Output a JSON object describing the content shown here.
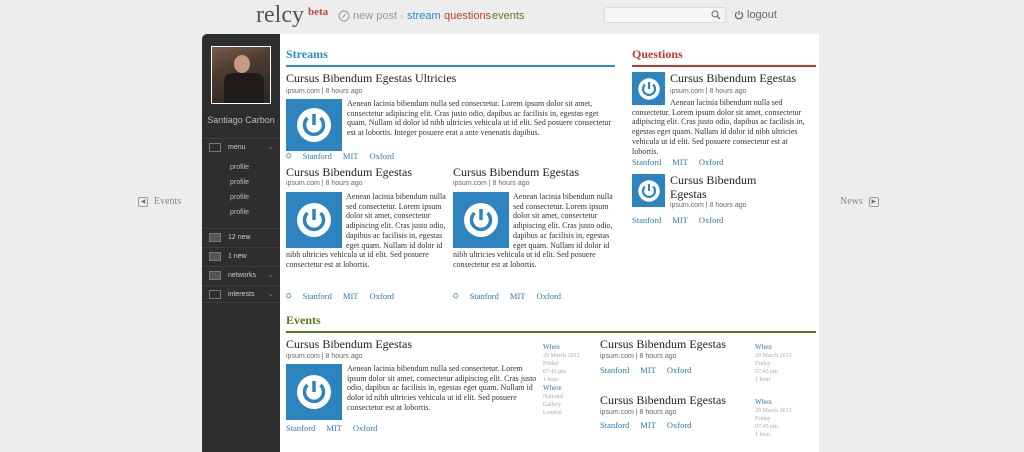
{
  "header": {
    "logo": "relcy",
    "beta": "beta",
    "newpost": "new post",
    "nav": [
      {
        "label": "stream",
        "color": "#2a8fc4"
      },
      {
        "label": "questions",
        "color": "#c0392b"
      },
      {
        "label": "events",
        "color": "#5b7a1e"
      }
    ],
    "search_placeholder": "",
    "logout": "logout"
  },
  "sidebar": {
    "username": "Santiago Carbon",
    "menu": "menu",
    "sub": [
      "profile",
      "profile",
      "profile",
      "profile"
    ],
    "new_a": "12 new",
    "new_b": "1 new",
    "networks": "networks",
    "interests": "interests"
  },
  "sidenav": {
    "left": "Events",
    "right": "News"
  },
  "streams": {
    "heading": "Streams",
    "main": {
      "title": "Cursus Bibendum Egestas Ultricies",
      "meta": "ipsum.com | 8 hours ago",
      "body": "Aenean lacinia bibendum nulla sed consectetur. Lorem ipsum dolor sit amet, consectetur adipiscing elit. Cras justo odio, dapibus ac facilisis in, egestas eget quam. Nullam id dolor id nibh ultricies vehicula ut id elit. Sed posuere consectetur est at lobortis. Integer posuere erat a ante venenatis dapibus.",
      "tags": [
        "Stanford",
        "MIT",
        "Oxford"
      ]
    },
    "small": [
      {
        "title": "Cursus Bibendum Egestas",
        "meta": "ipsum.com | 8 hours ago",
        "body": "Aenean lacinia bibendum nulla sed consectetur. Lorem ipsum dolor sit amet, consectetur adipiscing elit. Cras justo odio, dapibus ac facilisis in, egestas eget quam. Nullam id dolor id nibh ultricies vehicula ut id elit. Sed posuere consectetur est at lobortis.",
        "tags": [
          "Stanford",
          "MIT",
          "Oxford"
        ]
      },
      {
        "title": "Cursus Bibendum Egestas",
        "meta": "ipsum.com | 8 hours ago",
        "body": "Aenean lacinia bibendum nulla sed consectetur. Lorem ipsum dolor sit amet, consectetur adipiscing elit. Cras justo odio, dapibus ac facilisis in, egestas eget quam. Nullam id dolor id nibh ultricies vehicula ut id elit. Sed posuere consectetur est at lobortis.",
        "tags": [
          "Stanford",
          "MIT",
          "Oxford"
        ]
      }
    ]
  },
  "questions": {
    "heading": "Questions",
    "items": [
      {
        "title": "Cursus Bibendum Egestas",
        "meta": "ipsum.com | 8 hours ago",
        "body": "Aenean lacinia bibendum nulla sed consectetur. Lorem ipsum dolor sit amet, consectetur adipiscing elit. Cras justo odio, dapibus ac facilisis in, egestas eget quam. Nullam id dolor id nibh ultricies vehicula ut id elit. Sed posuere consectetur est at lobortis.",
        "tags": [
          "Stanford",
          "MIT",
          "Oxford"
        ]
      },
      {
        "title_1": "Cursus Bibendum",
        "title_2": "Egestas",
        "meta": "ipsum.com | 8 hours ago",
        "tags": [
          "Stanford",
          "MIT",
          "Oxford"
        ]
      }
    ]
  },
  "events": {
    "heading": "Events",
    "main": {
      "title": "Cursus Bibendum Egestas",
      "meta": "ipsum.com | 8 hours ago",
      "body": "Aenean lacinia bibendum nulla sed consectetur. Lorem ipsum dolor sit amet, consectetur adipiscing elit. Cras justo odio, dapibus ac facilisis in, egestas eget quam. Nullam id dolor id nibh ultricies vehicula ut id elit. Sed posuere consectetur est at lobortis.",
      "tags": [
        "Stanford",
        "MIT",
        "Oxford"
      ],
      "when_label": "When",
      "when": [
        "29 March 2012",
        "Friday",
        "07:45 pm",
        "1 hour"
      ],
      "where_label": "Where",
      "where": [
        "National",
        "Gallery",
        "London"
      ]
    },
    "side": [
      {
        "title": "Cursus Bibendum Egestas",
        "meta": "ipsum.com | 8 hours ago",
        "tags": [
          "Stanford",
          "MIT",
          "Oxford"
        ],
        "when_label": "When",
        "when": [
          "29 March 2012",
          "Friday",
          "07:45 pm",
          "1 hour"
        ]
      },
      {
        "title": "Cursus Bibendum Egestas",
        "meta": "ipsum.com | 8 hours ago",
        "tags": [
          "Stanford",
          "MIT",
          "Oxford"
        ],
        "when_label": "When",
        "when": [
          "29 March 2012",
          "Friday",
          "07:45 pm",
          "1 hour"
        ]
      }
    ]
  },
  "colors": {
    "streams": "#2a8fc4",
    "questions": "#c0392b",
    "events": "#5b7a1e",
    "thumb": "#2e84bf"
  }
}
